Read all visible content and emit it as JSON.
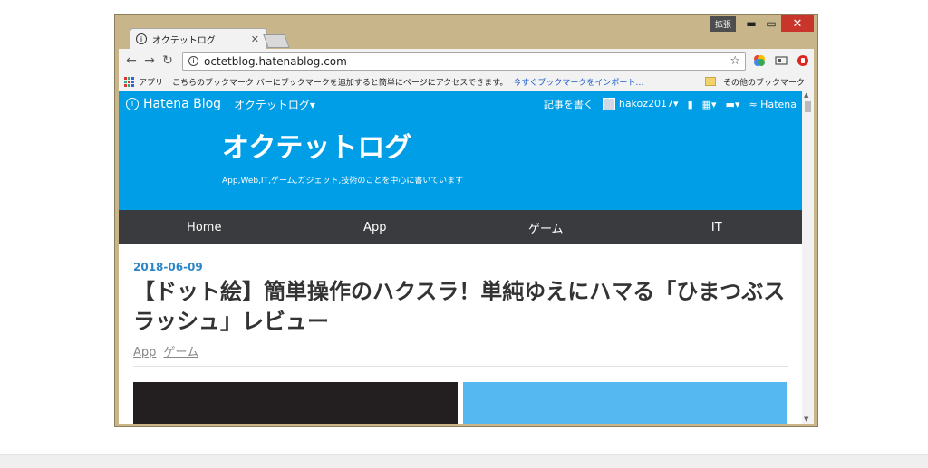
{
  "window": {
    "ime_label": "拡張",
    "controls": {
      "minimize": "▬",
      "maximize": "▭",
      "close": "✕"
    }
  },
  "tab": {
    "title": "オクテットログ",
    "close": "✕",
    "favicon": "i"
  },
  "toolbar": {
    "back": "←",
    "forward": "→",
    "reload": "↻",
    "info": "i",
    "url": "octetblog.hatenablog.com",
    "star": "☆"
  },
  "bookmarks_bar": {
    "apps_label": "アプリ",
    "hint": "こちらのブックマーク バーにブックマークを追加すると簡単にページにアクセスできます。",
    "import_link": "今すぐブックマークをインポート…",
    "other": "その他のブックマーク"
  },
  "hatena_bar": {
    "logo_mark": "i",
    "logo": "Hatena Blog",
    "blog_menu": "オクテットログ▾",
    "write": "記事を書く",
    "user": "hakoz2017▾",
    "bookmark_icon": "▮",
    "grid_icon": "▦▾",
    "notify_icon": "▬▾",
    "hatena": "≈ Hatena"
  },
  "blog": {
    "title": "オクテットログ",
    "description": "App,Web,IT,ゲーム,ガジェット,技術のことを中心に書いています"
  },
  "global_nav": [
    "Home",
    "App",
    "ゲーム",
    "IT"
  ],
  "article": {
    "date": "2018-06-09",
    "title": "【ドット絵】簡単操作のハクスラ！単純ゆえにハマる「ひまつぶスラッシュ」レビュー",
    "categories": [
      "App",
      "ゲーム"
    ]
  },
  "colors": {
    "accent": "#009ee6",
    "nav_bg": "#3a3b3f",
    "window_frame": "#c8b58a",
    "close_red": "#c8352b"
  }
}
